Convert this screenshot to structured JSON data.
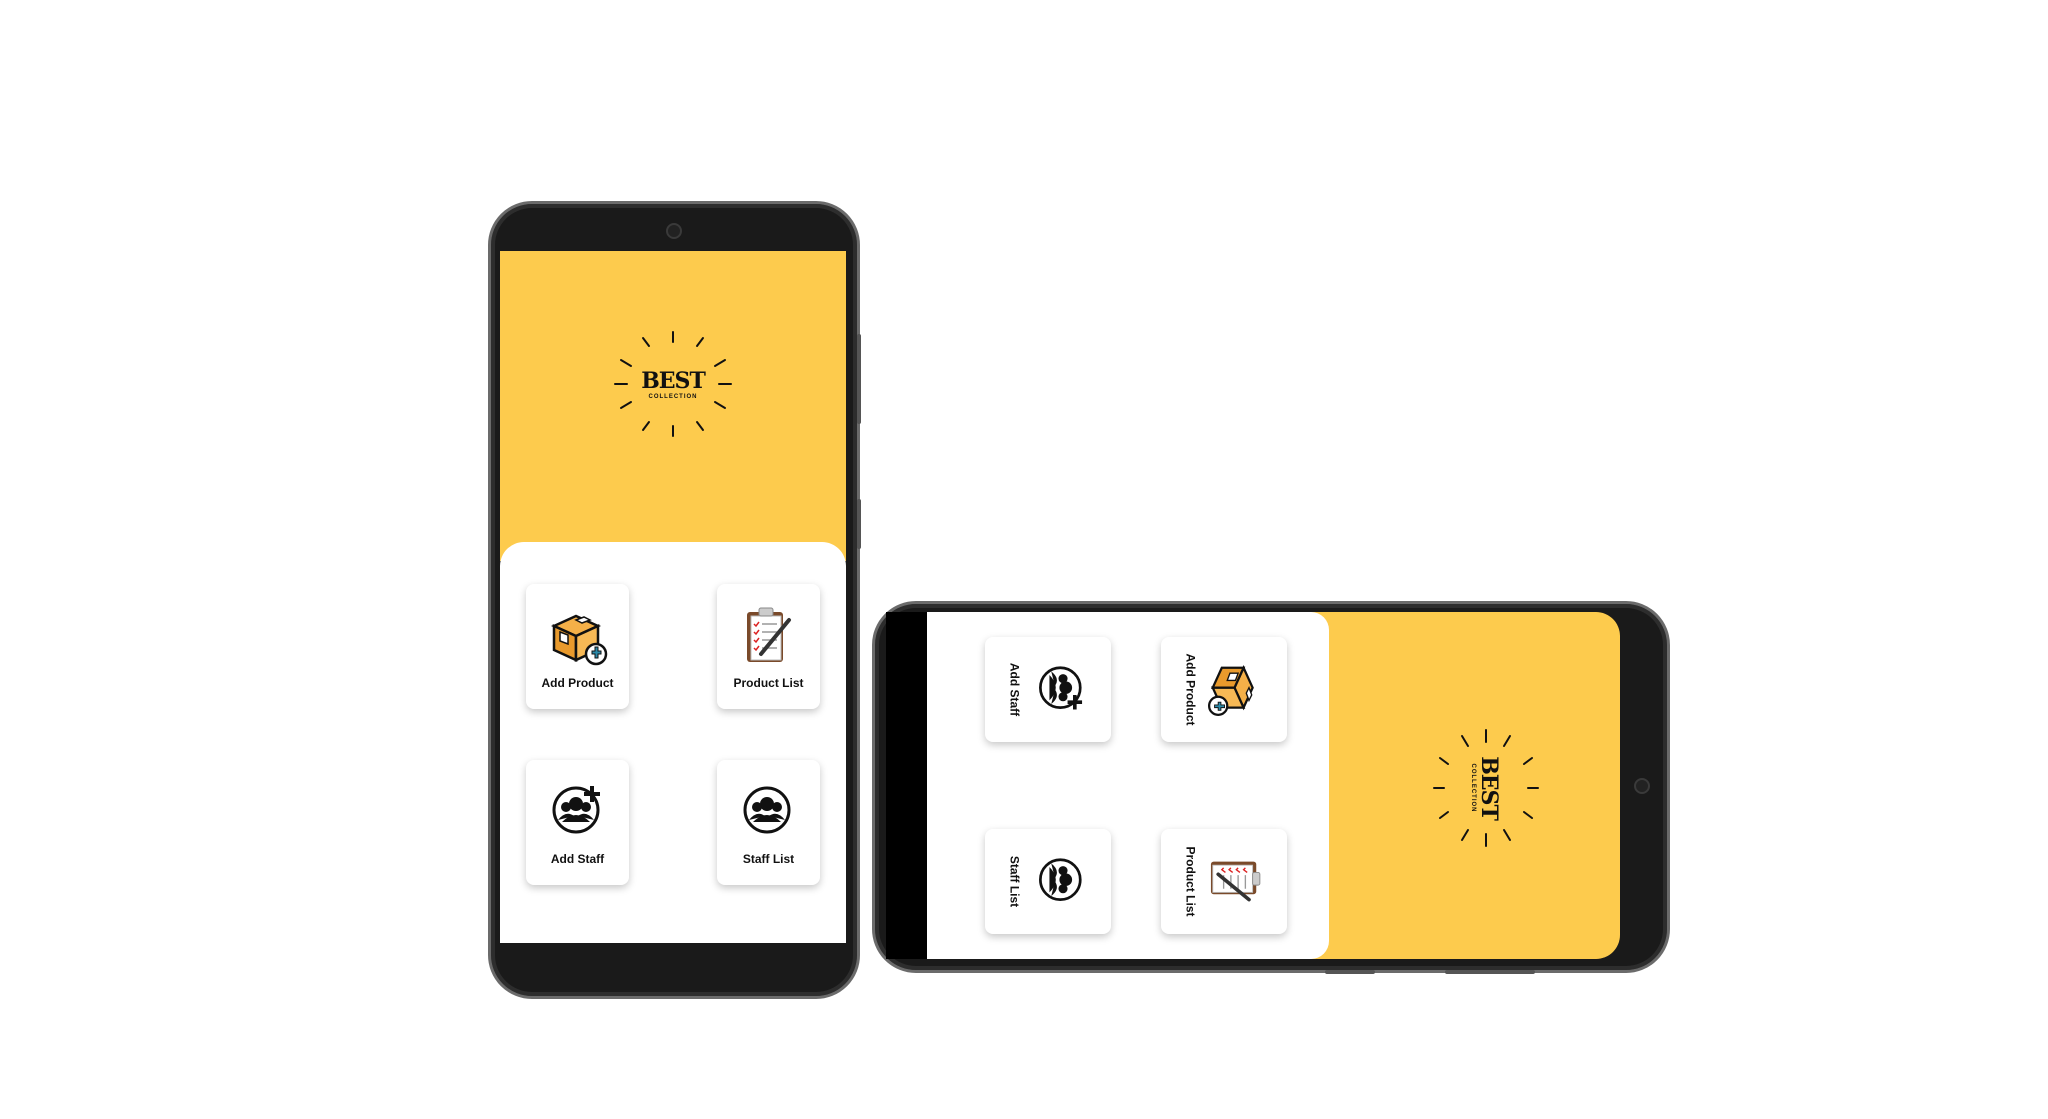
{
  "brand": {
    "name": "BEST",
    "tagline": "COLLECTION",
    "accent": "#fdcb4d"
  },
  "portrait": {
    "cards": [
      {
        "label": "Add Product",
        "icon": "add-product-box-icon"
      },
      {
        "label": "Product List",
        "icon": "clipboard-list-icon"
      },
      {
        "label": "Add Staff",
        "icon": "add-staff-icon"
      },
      {
        "label": "Staff List",
        "icon": "staff-group-icon"
      }
    ]
  },
  "landscape": {
    "cards": [
      {
        "label": "Add Staff",
        "icon": "add-staff-icon"
      },
      {
        "label": "Add Product",
        "icon": "add-product-box-icon"
      },
      {
        "label": "Staff List",
        "icon": "staff-group-icon"
      },
      {
        "label": "Product List",
        "icon": "clipboard-list-icon"
      }
    ]
  }
}
